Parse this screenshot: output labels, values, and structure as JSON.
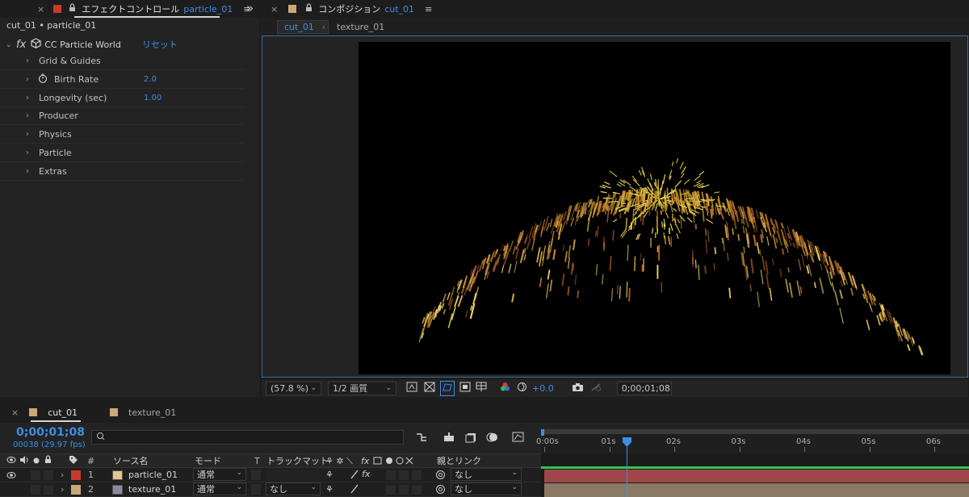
{
  "effect_panel": {
    "close": "×",
    "title": "エフェクトコントロール",
    "layer_name": "particle_01",
    "menu": "≡",
    "collapse": "»",
    "breadcrumb": "cut_01 • particle_01",
    "effect": {
      "fx_label": "fx",
      "name": "CC Particle World",
      "reset": "リセット"
    },
    "properties": [
      {
        "label": "Grid & Guides",
        "value": "",
        "stopwatch": false
      },
      {
        "label": "Birth Rate",
        "value": "2.0",
        "stopwatch": true
      },
      {
        "label": "Longevity (sec)",
        "value": "1.00",
        "stopwatch": false
      },
      {
        "label": "Producer",
        "value": "",
        "stopwatch": false
      },
      {
        "label": "Physics",
        "value": "",
        "stopwatch": false
      },
      {
        "label": "Particle",
        "value": "",
        "stopwatch": false
      },
      {
        "label": "Extras",
        "value": "",
        "stopwatch": false
      }
    ],
    "colors": {
      "label_swatch": "#c83a2c",
      "value_blue": "#3d8ee8"
    }
  },
  "comp_panel": {
    "close": "×",
    "title_prefix": "コンポジション",
    "comp_name": "cut_01",
    "menu": "≡",
    "subtabs": [
      "cut_01",
      "texture_01"
    ],
    "subtab_arrow": "‹",
    "viewer_bar": {
      "zoom": "(57.8 %)",
      "resolution": "1/2 画質",
      "exposure": "+0.0",
      "timecode": "0;00;01;08"
    },
    "colors": {
      "swatch": "#c9a97a"
    }
  },
  "timeline": {
    "tabs": [
      {
        "close": "×",
        "label": "cut_01",
        "active": true
      },
      {
        "close": "",
        "label": "texture_01",
        "active": false
      }
    ],
    "current_time": "0;00;01;08",
    "frame_info": "00038 (29.97 fps)",
    "search_placeholder": "",
    "header": {
      "num": "#",
      "source_name": "ソース名",
      "mode": "モード",
      "t": "T",
      "track_matte": "トラックマット",
      "parent_link": "親とリンク"
    },
    "layers": [
      {
        "num": "1",
        "name": "particle_01",
        "mode": "通常",
        "matte": "",
        "parent": "なし",
        "label_color": "#c83a2c",
        "icon_color": "#e6c68a"
      },
      {
        "num": "2",
        "name": "texture_01",
        "mode": "通常",
        "matte": "なし",
        "parent": "なし",
        "label_color": "#c9a97a",
        "icon_color": "#8a8aa0"
      }
    ],
    "ruler_ticks": [
      "0:00s",
      "01s",
      "02s",
      "03s",
      "04s",
      "05s",
      "06s"
    ],
    "playhead_seconds": 1.27,
    "colors": {
      "bar1": "#a0454a",
      "bar2": "#8a7a64",
      "work_area": "#2ac84a",
      "playhead": "#3d8ee8"
    }
  }
}
